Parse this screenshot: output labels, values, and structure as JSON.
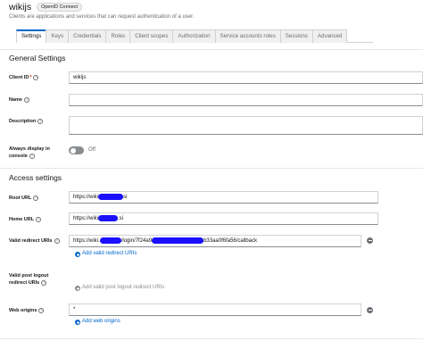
{
  "header": {
    "title": "wikijs",
    "badge": "OpenID Connect",
    "subtitle": "Clients are applications and services that can request authentication of a user."
  },
  "tabs": [
    {
      "label": "Settings",
      "active": true
    },
    {
      "label": "Keys"
    },
    {
      "label": "Credentials"
    },
    {
      "label": "Roles"
    },
    {
      "label": "Client scopes"
    },
    {
      "label": "Authorization"
    },
    {
      "label": "Service accounts roles"
    },
    {
      "label": "Sessions"
    },
    {
      "label": "Advanced"
    }
  ],
  "general": {
    "title": "General Settings",
    "client_id_label": "Client ID",
    "client_id_value": "wikijs",
    "name_label": "Name",
    "name_value": "",
    "description_label": "Description",
    "always_display_label_1": "Always display in",
    "always_display_label_2": "console",
    "always_display_state": "Off"
  },
  "access": {
    "title": "Access settings",
    "root_url_label": "Root URL",
    "root_url_prefix": "https://wiki",
    "root_url_suffix": "si",
    "home_url_label": "Home URL",
    "home_url_prefix": "https://wiki",
    "home_url_suffix": ".si",
    "redirect_label": "Valid redirect URIs",
    "redirect_part1": "https://wiki.",
    "redirect_part2": "/login/7f24a9",
    "redirect_part3": "b33aa0f6fa56/callback",
    "add_redirect": "Add valid redirect URIs",
    "post_logout_label_1": "Valid post logout",
    "post_logout_label_2": "redirect URIs",
    "add_post_logout": "Add valid post logout redirect URIs",
    "web_origins_label": "Web origins",
    "web_origins_value": "*",
    "add_web_origins": "Add web origins"
  },
  "colors": {
    "accent": "#0066cc",
    "redaction": "#1a10ff",
    "required": "#c9190b"
  },
  "icons": [
    "help-icon",
    "minus-circle-icon",
    "plus-circle-icon"
  ]
}
